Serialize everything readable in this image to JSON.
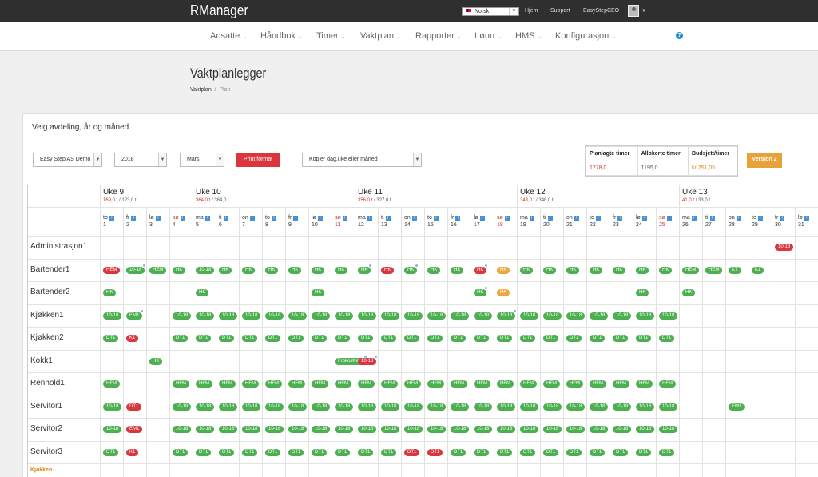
{
  "header": {
    "brand": "RManager",
    "language": "Norsk",
    "links": [
      "Hjem",
      "Support",
      "EasyStepCEO"
    ]
  },
  "nav": [
    "Ansatte",
    "Håndbok",
    "Timer",
    "Vaktplan",
    "Rapporter",
    "Lønn",
    "HMS",
    "Konfigurasjon"
  ],
  "page": {
    "title": "Vaktplanlegger",
    "breadcrumb": [
      "Vaktplan",
      "Plan"
    ],
    "panel_title": "Velg avdeling, år og måned"
  },
  "filters": {
    "department": "Easy Step AS Demo",
    "year": "2018",
    "month": "Mars",
    "print_label": "Print format",
    "copy_placeholder": "Kopier dag,uke eller måned"
  },
  "stats": {
    "headers": [
      "Planlagte timer",
      "Allokerte timer",
      "Budsjett/timer"
    ],
    "values": [
      "1278,0",
      "1195,0",
      "kr 251,05"
    ]
  },
  "version_label": "Versjon 2",
  "colors": {
    "accent": "#e8a23b",
    "print": "#d9363e",
    "shift_green": "#4caf50",
    "shift_red": "#d9363e",
    "shift_orange": "#f0a43a",
    "section": "#e0891a"
  },
  "weeks": [
    {
      "label": "Uke 9",
      "h1": "169,0 t",
      "h2": "123,0 t"
    },
    {
      "label": "Uke 10",
      "h1": "364,0 t",
      "h2": "364,0 t"
    },
    {
      "label": "Uke 11",
      "h1": "356,0 t",
      "h2": "327,0 t"
    },
    {
      "label": "Uke 12",
      "h1": "348,0 t",
      "h2": "348,0 t"
    },
    {
      "label": "Uke 13",
      "h1": "41,0 t",
      "h2": "33,0 t"
    }
  ],
  "days": [
    {
      "d": "to",
      "n": "1"
    },
    {
      "d": "fr",
      "n": "2"
    },
    {
      "d": "lø",
      "n": "3"
    },
    {
      "d": "sø",
      "n": "4",
      "red": true
    },
    {
      "d": "ma",
      "n": "5"
    },
    {
      "d": "ti",
      "n": "6"
    },
    {
      "d": "on",
      "n": "7"
    },
    {
      "d": "to",
      "n": "8"
    },
    {
      "d": "fr",
      "n": "9"
    },
    {
      "d": "lø",
      "n": "10"
    },
    {
      "d": "sø",
      "n": "11",
      "red": true
    },
    {
      "d": "ma",
      "n": "12"
    },
    {
      "d": "ti",
      "n": "13"
    },
    {
      "d": "on",
      "n": "14"
    },
    {
      "d": "to",
      "n": "15"
    },
    {
      "d": "fr",
      "n": "16"
    },
    {
      "d": "lø",
      "n": "17"
    },
    {
      "d": "sø",
      "n": "18",
      "red": true
    },
    {
      "d": "ma",
      "n": "19"
    },
    {
      "d": "ti",
      "n": "20"
    },
    {
      "d": "on",
      "n": "21"
    },
    {
      "d": "to",
      "n": "22"
    },
    {
      "d": "fr",
      "n": "23"
    },
    {
      "d": "lø",
      "n": "24"
    },
    {
      "d": "sø",
      "n": "25",
      "red": true
    },
    {
      "d": "ma",
      "n": "26"
    },
    {
      "d": "ti",
      "n": "27"
    },
    {
      "d": "on",
      "n": "28"
    },
    {
      "d": "to",
      "n": "29"
    },
    {
      "d": "fr",
      "n": "30"
    },
    {
      "d": "lø",
      "n": "31"
    }
  ],
  "rows": [
    {
      "name": "Administrasjon1",
      "shifts": [
        [
          29,
          "10-18",
          "r"
        ]
      ]
    },
    {
      "name": "Bartender1",
      "shifts": [
        [
          0,
          "HEM",
          "r"
        ],
        [
          1,
          "10-18",
          "g",
          1
        ],
        [
          2,
          "HEM",
          "g"
        ],
        [
          3,
          "HK",
          "g"
        ],
        [
          4,
          "10-18",
          "g"
        ],
        [
          5,
          "HK",
          "g"
        ],
        [
          6,
          "HK",
          "g"
        ],
        [
          7,
          "HK",
          "g"
        ],
        [
          8,
          "HK",
          "g"
        ],
        [
          9,
          "HK",
          "g"
        ],
        [
          10,
          "HK",
          "g"
        ],
        [
          11,
          "HK",
          "g",
          1
        ],
        [
          12,
          "HK",
          "r"
        ],
        [
          13,
          "HK",
          "g",
          1
        ],
        [
          14,
          "HK",
          "g"
        ],
        [
          15,
          "HK",
          "g"
        ],
        [
          16,
          "HK",
          "r",
          1
        ],
        [
          17,
          "HK",
          "o"
        ],
        [
          18,
          "HK",
          "g"
        ],
        [
          19,
          "HK",
          "g"
        ],
        [
          20,
          "HK",
          "g"
        ],
        [
          21,
          "HK",
          "g"
        ],
        [
          22,
          "HK",
          "g"
        ],
        [
          23,
          "HK",
          "g"
        ],
        [
          24,
          "HK",
          "g"
        ],
        [
          25,
          "HEM",
          "g"
        ],
        [
          26,
          "HEM",
          "g"
        ],
        [
          27,
          "KT",
          "g"
        ],
        [
          28,
          "K1",
          "g"
        ]
      ]
    },
    {
      "name": "Bartender2",
      "shifts": [
        [
          0,
          "HK",
          "g"
        ],
        [
          4,
          "HK",
          "g"
        ],
        [
          9,
          "HK",
          "g"
        ],
        [
          16,
          "HK",
          "g",
          1
        ],
        [
          17,
          "HK",
          "o"
        ],
        [
          23,
          "HK",
          "g"
        ],
        [
          25,
          "HK",
          "g"
        ]
      ]
    },
    {
      "name": "Kjøkken1",
      "shifts": [
        [
          0,
          "10-18",
          "g"
        ],
        [
          1,
          "EM1",
          "g",
          1
        ],
        [
          3,
          "10-18",
          "g"
        ],
        [
          4,
          "10-18",
          "g"
        ],
        [
          5,
          "10-18",
          "g"
        ],
        [
          6,
          "10-18",
          "g"
        ],
        [
          7,
          "10-18",
          "g"
        ],
        [
          8,
          "10-18",
          "g"
        ],
        [
          9,
          "10-18",
          "g"
        ],
        [
          10,
          "10-18",
          "g"
        ],
        [
          11,
          "10-18",
          "g"
        ],
        [
          12,
          "10-18",
          "g"
        ],
        [
          13,
          "10-18",
          "g"
        ],
        [
          14,
          "10-18",
          "g"
        ],
        [
          15,
          "10-18",
          "g"
        ],
        [
          16,
          "10-18",
          "g"
        ],
        [
          17,
          "10-18",
          "g",
          1
        ],
        [
          18,
          "10-18",
          "g"
        ],
        [
          19,
          "10-18",
          "g"
        ],
        [
          20,
          "10-18",
          "g"
        ],
        [
          21,
          "10-18",
          "g"
        ],
        [
          22,
          "10-18",
          "g"
        ],
        [
          23,
          "10-18",
          "g"
        ],
        [
          24,
          "10-18",
          "g"
        ]
      ]
    },
    {
      "name": "Kjøkken2",
      "shifts": [
        [
          0,
          "DT1",
          "g"
        ],
        [
          1,
          "K1",
          "r"
        ],
        [
          3,
          "DT1",
          "g"
        ],
        [
          4,
          "DT1",
          "g"
        ],
        [
          5,
          "DT1",
          "g"
        ],
        [
          6,
          "DT1",
          "g"
        ],
        [
          7,
          "DT1",
          "g"
        ],
        [
          8,
          "DT1",
          "g"
        ],
        [
          9,
          "DT1",
          "g"
        ],
        [
          10,
          "DT1",
          "g"
        ],
        [
          11,
          "DT1",
          "g"
        ],
        [
          12,
          "DT1",
          "g"
        ],
        [
          13,
          "DT1",
          "g"
        ],
        [
          14,
          "DT1",
          "g"
        ],
        [
          15,
          "DT1",
          "g"
        ],
        [
          16,
          "DT1",
          "g"
        ],
        [
          17,
          "DT1",
          "g"
        ],
        [
          18,
          "DT1",
          "g"
        ],
        [
          19,
          "DT1",
          "g"
        ],
        [
          20,
          "DT1",
          "g"
        ],
        [
          21,
          "DT1",
          "g"
        ],
        [
          22,
          "DT1",
          "g"
        ],
        [
          23,
          "DT1",
          "g"
        ],
        [
          24,
          "DT1",
          "g"
        ]
      ]
    },
    {
      "name": "Kokk1",
      "shifts": [
        [
          2,
          "HK",
          "g"
        ],
        [
          10,
          "Frokostvakt",
          "g",
          1
        ],
        [
          11,
          "10-18",
          "r",
          1
        ]
      ]
    },
    {
      "name": "Renhold1",
      "shifts": [
        [
          0,
          "HFM",
          "g"
        ],
        [
          3,
          "HFM",
          "g"
        ],
        [
          4,
          "HFM",
          "g"
        ],
        [
          5,
          "HFM",
          "g"
        ],
        [
          6,
          "HFM",
          "g"
        ],
        [
          7,
          "HFM",
          "g"
        ],
        [
          8,
          "HFM",
          "g"
        ],
        [
          9,
          "HFM",
          "g"
        ],
        [
          10,
          "HFM",
          "g"
        ],
        [
          11,
          "HFM",
          "g"
        ],
        [
          12,
          "HFM",
          "g"
        ],
        [
          13,
          "HFM",
          "g"
        ],
        [
          14,
          "HFM",
          "g"
        ],
        [
          15,
          "HFM",
          "g"
        ],
        [
          16,
          "HFM",
          "g"
        ],
        [
          17,
          "HFM",
          "g"
        ],
        [
          18,
          "HFM",
          "g"
        ],
        [
          19,
          "HFM",
          "g"
        ],
        [
          20,
          "HFM",
          "g"
        ],
        [
          21,
          "HFM",
          "g"
        ],
        [
          22,
          "HFM",
          "g"
        ],
        [
          23,
          "HFM",
          "g"
        ],
        [
          24,
          "HFM",
          "g"
        ]
      ]
    },
    {
      "name": "Servitor1",
      "shifts": [
        [
          0,
          "10-18",
          "g"
        ],
        [
          1,
          "DT1",
          "r"
        ],
        [
          3,
          "10-18",
          "g"
        ],
        [
          4,
          "10-18",
          "g"
        ],
        [
          5,
          "10-18",
          "g"
        ],
        [
          6,
          "10-18",
          "g"
        ],
        [
          7,
          "10-18",
          "g"
        ],
        [
          8,
          "10-18",
          "g"
        ],
        [
          9,
          "10-18",
          "g"
        ],
        [
          10,
          "10-18",
          "g"
        ],
        [
          11,
          "10-18",
          "g"
        ],
        [
          12,
          "10-18",
          "g"
        ],
        [
          13,
          "10-18",
          "g"
        ],
        [
          14,
          "10-18",
          "g"
        ],
        [
          15,
          "10-18",
          "g"
        ],
        [
          16,
          "10-18",
          "g"
        ],
        [
          17,
          "10-18",
          "g"
        ],
        [
          18,
          "10-18",
          "g"
        ],
        [
          19,
          "10-18",
          "g"
        ],
        [
          20,
          "10-18",
          "g"
        ],
        [
          21,
          "10-18",
          "g"
        ],
        [
          22,
          "10-18",
          "g"
        ],
        [
          23,
          "10-18",
          "g"
        ],
        [
          24,
          "10-18",
          "g"
        ],
        [
          27,
          "EM1",
          "g"
        ]
      ]
    },
    {
      "name": "Servitor2",
      "shifts": [
        [
          0,
          "10-18",
          "g"
        ],
        [
          1,
          "EM1",
          "r"
        ],
        [
          3,
          "10-18",
          "g"
        ],
        [
          4,
          "10-18",
          "g"
        ],
        [
          5,
          "10-18",
          "g"
        ],
        [
          6,
          "10-18",
          "g"
        ],
        [
          7,
          "10-18",
          "g"
        ],
        [
          8,
          "10-18",
          "g"
        ],
        [
          9,
          "10-18",
          "g"
        ],
        [
          10,
          "10-18",
          "g"
        ],
        [
          11,
          "10-18",
          "g"
        ],
        [
          12,
          "10-18",
          "g"
        ],
        [
          13,
          "10-18",
          "g"
        ],
        [
          14,
          "10-18",
          "g"
        ],
        [
          15,
          "10-18",
          "g"
        ],
        [
          16,
          "10-18",
          "g"
        ],
        [
          17,
          "10-18",
          "g"
        ],
        [
          18,
          "10-18",
          "g"
        ],
        [
          19,
          "10-18",
          "g"
        ],
        [
          20,
          "10-18",
          "g"
        ],
        [
          21,
          "10-18",
          "g"
        ],
        [
          22,
          "10-18",
          "g"
        ],
        [
          23,
          "10-18",
          "g"
        ],
        [
          24,
          "10-18",
          "g"
        ]
      ]
    },
    {
      "name": "Servitor3",
      "shifts": [
        [
          0,
          "DT1",
          "g"
        ],
        [
          1,
          "K1",
          "r"
        ],
        [
          3,
          "DT1",
          "g"
        ],
        [
          4,
          "DT1",
          "g"
        ],
        [
          5,
          "DT1",
          "g"
        ],
        [
          6,
          "DT1",
          "g"
        ],
        [
          7,
          "DT1",
          "g"
        ],
        [
          8,
          "DT1",
          "g"
        ],
        [
          9,
          "DT1",
          "g"
        ],
        [
          10,
          "DT1",
          "g"
        ],
        [
          11,
          "DT1",
          "g"
        ],
        [
          12,
          "DT1",
          "g"
        ],
        [
          13,
          "DT1",
          "r"
        ],
        [
          14,
          "DT1",
          "r"
        ],
        [
          15,
          "DT1",
          "g"
        ],
        [
          16,
          "DT1",
          "g"
        ],
        [
          17,
          "DT1",
          "g"
        ],
        [
          18,
          "DT1",
          "g"
        ],
        [
          19,
          "DT1",
          "g"
        ],
        [
          20,
          "DT1",
          "g"
        ],
        [
          21,
          "DT1",
          "g"
        ],
        [
          22,
          "DT1",
          "g"
        ],
        [
          23,
          "DT1",
          "g"
        ],
        [
          24,
          "DT1",
          "g"
        ]
      ]
    }
  ],
  "section_label": "Kjøkken"
}
